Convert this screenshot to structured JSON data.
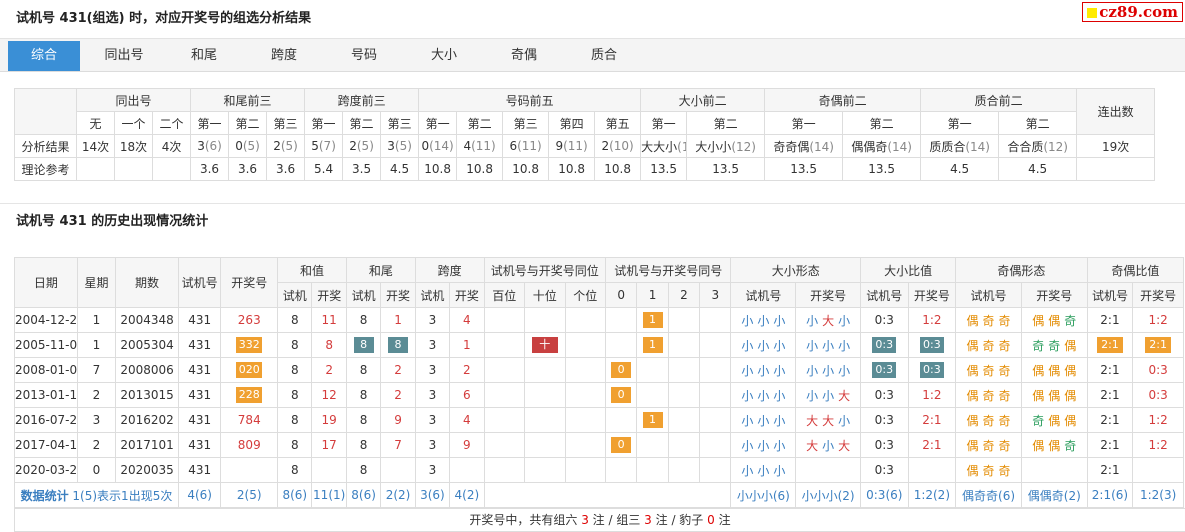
{
  "page_title": "试机号 431(组选) 时，对应开奖号的组选分析结果",
  "logo_text": "cz89.com",
  "tabs": [
    "综合",
    "同出号",
    "和尾",
    "跨度",
    "号码",
    "大小",
    "奇偶",
    "质合"
  ],
  "analysis": {
    "groups": [
      "同出号",
      "和尾前三",
      "跨度前三",
      "号码前五",
      "大小前二",
      "奇偶前二",
      "质合前二",
      "连出数"
    ],
    "subheaders": [
      "无",
      "一个",
      "二个",
      "第一",
      "第二",
      "第三",
      "第一",
      "第二",
      "第三",
      "第一",
      "第二",
      "第三",
      "第四",
      "第五",
      "第一",
      "第二",
      "第一",
      "第二",
      "第一",
      "第二"
    ],
    "row1_label": "分析结果",
    "row1": [
      {
        "v": "14次"
      },
      {
        "v": "18次"
      },
      {
        "v": "4次"
      },
      {
        "v": "3",
        "n": "(6)"
      },
      {
        "v": "0",
        "n": "(5)"
      },
      {
        "v": "2",
        "n": "(5)"
      },
      {
        "v": "5",
        "n": "(7)"
      },
      {
        "v": "2",
        "n": "(5)"
      },
      {
        "v": "3",
        "n": "(5)"
      },
      {
        "v": "0",
        "n": "(14)"
      },
      {
        "v": "4",
        "n": "(11)"
      },
      {
        "v": "6",
        "n": "(11)"
      },
      {
        "v": "9",
        "n": "(11)"
      },
      {
        "v": "2",
        "n": "(10)"
      },
      {
        "v": "大大小",
        "n": "(14)"
      },
      {
        "v": "大小小",
        "n": "(12)"
      },
      {
        "v": "奇奇偶",
        "n": "(14)"
      },
      {
        "v": "偶偶奇",
        "n": "(14)"
      },
      {
        "v": "质质合",
        "n": "(14)"
      },
      {
        "v": "合合质",
        "n": "(12)"
      },
      {
        "v": "19次"
      }
    ],
    "row2_label": "理论参考",
    "row2": [
      "",
      "",
      "",
      "3.6",
      "3.6",
      "3.6",
      "5.4",
      "3.5",
      "4.5",
      "10.8",
      "10.8",
      "10.8",
      "10.8",
      "10.8",
      "13.5",
      "13.5",
      "13.5",
      "13.5",
      "4.5",
      "4.5",
      ""
    ]
  },
  "history_title": "试机号 431 的历史出现情况统计",
  "history": {
    "headers_top": [
      "日期",
      "星期",
      "期数",
      "试机号",
      "开奖号",
      "和值",
      "和尾",
      "跨度",
      "试机号与开奖号同位",
      "试机号与开奖号同号",
      "大小形态",
      "大小比值",
      "奇偶形态",
      "奇偶比值"
    ],
    "headers_sub": [
      "试机",
      "开奖",
      "试机",
      "开奖",
      "试机",
      "开奖",
      "百位",
      "十位",
      "个位",
      "0",
      "1",
      "2",
      "3",
      "试机号",
      "开奖号",
      "试机号",
      "开奖号",
      "试机号",
      "开奖号",
      "试机号",
      "开奖号"
    ],
    "rows": [
      {
        "date": "2004-12-20",
        "week": "1",
        "issue": "2004348",
        "shiji": "431",
        "kaijiang": "263",
        "kj_box": false,
        "hz_s": "8",
        "hz_k": "11",
        "hw_s": "8",
        "hw_k": "1",
        "hw_box": false,
        "kd_s": "3",
        "kd_k": "4",
        "same_pos": [
          "",
          "",
          ""
        ],
        "same_num": [
          "",
          "1",
          "",
          ""
        ],
        "dx_s": "小小小",
        "dx_k": "小大小",
        "dxb_s": "0:3",
        "dxb_k": "1:2",
        "dxb_box": false,
        "jo_s": "偶奇奇",
        "jo_k": "偶偶奇",
        "job_s": "2:1",
        "job_k": "1:2",
        "job_box": false
      },
      {
        "date": "2005-11-07",
        "week": "1",
        "issue": "2005304",
        "shiji": "431",
        "kaijiang": "332",
        "kj_box": true,
        "hz_s": "8",
        "hz_k": "8",
        "hw_s": "8",
        "hw_k": "8",
        "hw_box": true,
        "kd_s": "3",
        "kd_k": "1",
        "same_pos": [
          "",
          "十",
          ""
        ],
        "same_num": [
          "",
          "1",
          "",
          ""
        ],
        "dx_s": "小小小",
        "dx_k": "小小小",
        "dxb_s": "0:3",
        "dxb_k": "0:3",
        "dxb_box": true,
        "jo_s": "偶奇奇",
        "jo_k": "奇奇偶",
        "job_s": "2:1",
        "job_k": "2:1",
        "job_box": true
      },
      {
        "date": "2008-01-06",
        "week": "7",
        "issue": "2008006",
        "shiji": "431",
        "kaijiang": "020",
        "kj_box": true,
        "hz_s": "8",
        "hz_k": "2",
        "hw_s": "8",
        "hw_k": "2",
        "hw_box": false,
        "kd_s": "3",
        "kd_k": "2",
        "same_pos": [
          "",
          "",
          ""
        ],
        "same_num": [
          "0",
          "",
          "",
          ""
        ],
        "dx_s": "小小小",
        "dx_k": "小小小",
        "dxb_s": "0:3",
        "dxb_k": "0:3",
        "dxb_box": true,
        "jo_s": "偶奇奇",
        "jo_k": "偶偶偶",
        "job_s": "2:1",
        "job_k": "0:3",
        "job_box": false
      },
      {
        "date": "2013-01-15",
        "week": "2",
        "issue": "2013015",
        "shiji": "431",
        "kaijiang": "228",
        "kj_box": true,
        "hz_s": "8",
        "hz_k": "12",
        "hw_s": "8",
        "hw_k": "2",
        "hw_box": false,
        "kd_s": "3",
        "kd_k": "6",
        "same_pos": [
          "",
          "",
          ""
        ],
        "same_num": [
          "0",
          "",
          "",
          ""
        ],
        "dx_s": "小小小",
        "dx_k": "小小大",
        "dxb_s": "0:3",
        "dxb_k": "1:2",
        "dxb_box": false,
        "jo_s": "偶奇奇",
        "jo_k": "偶偶偶",
        "job_s": "2:1",
        "job_k": "0:3",
        "job_box": false
      },
      {
        "date": "2016-07-27",
        "week": "3",
        "issue": "2016202",
        "shiji": "431",
        "kaijiang": "784",
        "kj_box": false,
        "hz_s": "8",
        "hz_k": "19",
        "hw_s": "8",
        "hw_k": "9",
        "hw_box": false,
        "kd_s": "3",
        "kd_k": "4",
        "same_pos": [
          "",
          "",
          ""
        ],
        "same_num": [
          "",
          "1",
          "",
          ""
        ],
        "dx_s": "小小小",
        "dx_k": "大大小",
        "dxb_s": "0:3",
        "dxb_k": "2:1",
        "dxb_box": false,
        "jo_s": "偶奇奇",
        "jo_k": "奇偶偶",
        "job_s": "2:1",
        "job_k": "1:2",
        "job_box": false
      },
      {
        "date": "2017-04-18",
        "week": "2",
        "issue": "2017101",
        "shiji": "431",
        "kaijiang": "809",
        "kj_box": false,
        "hz_s": "8",
        "hz_k": "17",
        "hw_s": "8",
        "hw_k": "7",
        "hw_box": false,
        "kd_s": "3",
        "kd_k": "9",
        "same_pos": [
          "",
          "",
          ""
        ],
        "same_num": [
          "0",
          "",
          "",
          ""
        ],
        "dx_s": "小小小",
        "dx_k": "大小大",
        "dxb_s": "0:3",
        "dxb_k": "2:1",
        "dxb_box": false,
        "jo_s": "偶奇奇",
        "jo_k": "偶偶奇",
        "job_s": "2:1",
        "job_k": "1:2",
        "job_box": false
      },
      {
        "date": "2020-03-24",
        "week": "0",
        "issue": "2020035",
        "shiji": "431",
        "kaijiang": "",
        "kj_box": false,
        "hz_s": "8",
        "hz_k": "",
        "hw_s": "8",
        "hw_k": "",
        "hw_box": false,
        "kd_s": "3",
        "kd_k": "",
        "same_pos": [
          "",
          "",
          ""
        ],
        "same_num": [
          "",
          "",
          "",
          ""
        ],
        "dx_s": "小小小",
        "dx_k": "",
        "dxb_s": "0:3",
        "dxb_k": "",
        "dxb_box": false,
        "jo_s": "偶奇奇",
        "jo_k": "",
        "job_s": "2:1",
        "job_k": "",
        "job_box": false
      }
    ],
    "stats": {
      "label": "数据统计",
      "note": "1(5)表示1出现5次",
      "shiji": "4(6)",
      "kaijiang": "2(5)",
      "hz_s": "8(6)",
      "hz_k": "11(1)",
      "hw_s": "8(6)",
      "hw_k": "2(2)",
      "kd_s": "3(6)",
      "kd_k": "4(2)",
      "dx_s": "小小小(6)",
      "dx_k": "小小小(2)",
      "dxb_s": "0:3(6)",
      "dxb_k": "1:2(2)",
      "jo_s": "偶奇奇(6)",
      "jo_k": "偶偶奇(2)",
      "job_s": "2:1(6)",
      "job_k": "1:2(3)"
    },
    "footer": {
      "prefix": "开奖号中，共有组六 ",
      "z6": "3",
      "mid1": " 注 / 组三 ",
      "z3": "3",
      "mid2": " 注 / 豹子 ",
      "bz": "0",
      "suffix": " 注"
    }
  }
}
